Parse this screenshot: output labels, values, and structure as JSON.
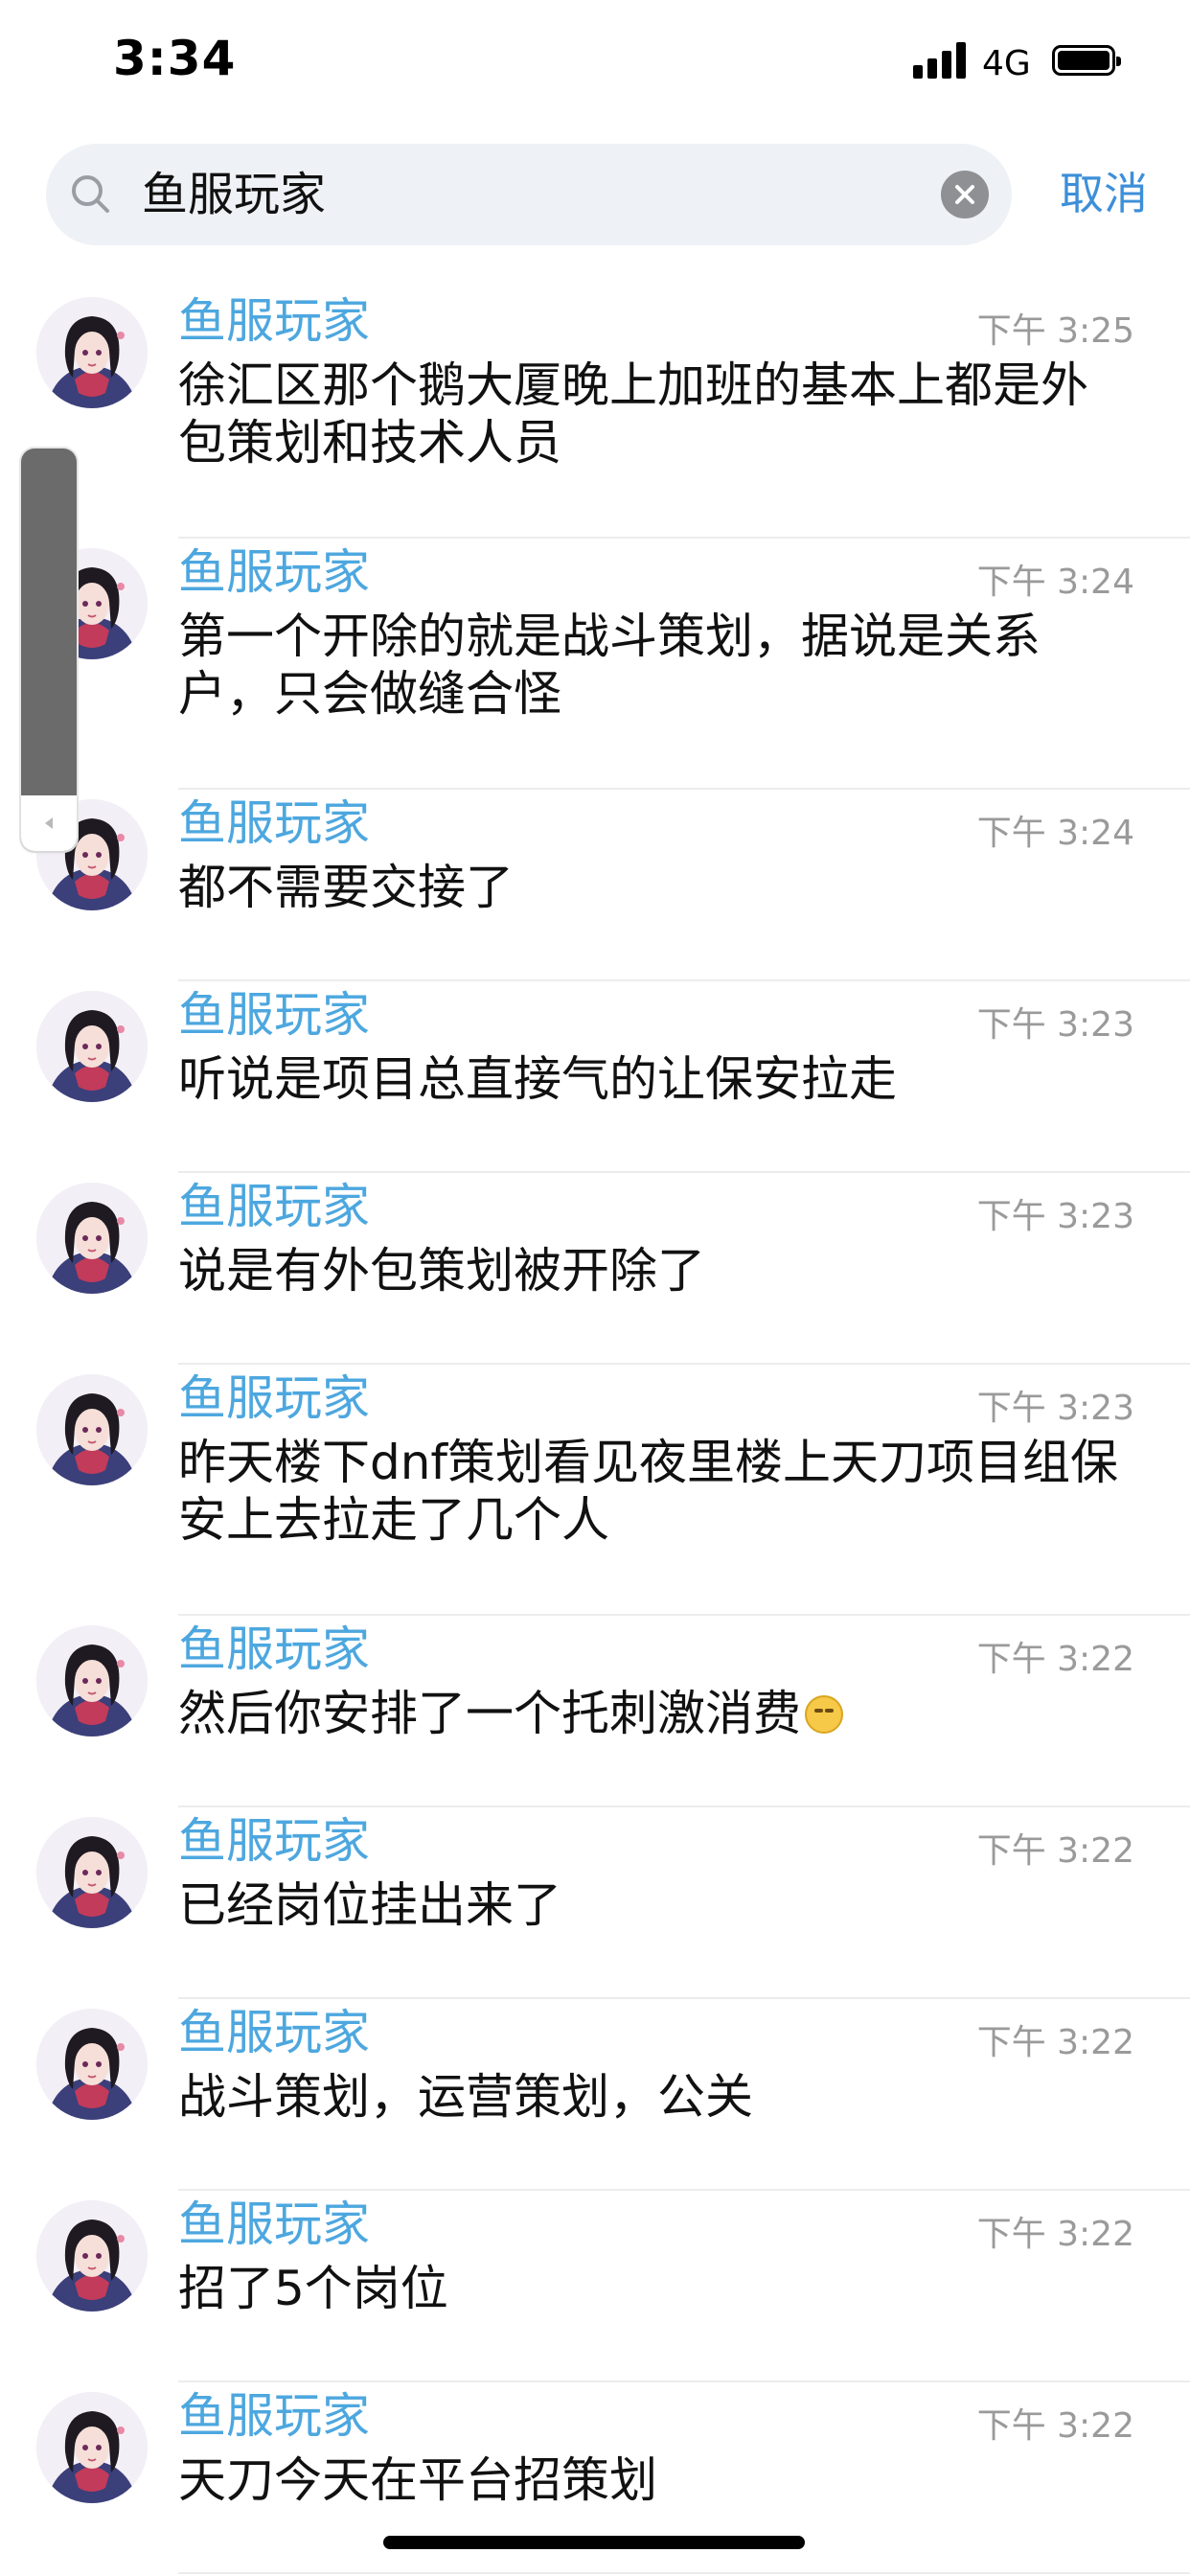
{
  "status_bar": {
    "time": "3:34",
    "network": "4G",
    "signal_icon": "signal-bars-icon",
    "battery_icon": "battery-full-icon"
  },
  "search": {
    "query": "鱼服玩家",
    "cancel_label": "取消",
    "icon": "search-icon",
    "clear_icon": "clear-icon"
  },
  "colors": {
    "accent": "#3d8fd8",
    "sender_name": "#4da7df",
    "timestamp": "#9a9a9a",
    "search_bg": "#eef1f5"
  },
  "results": [
    {
      "sender": "鱼服玩家",
      "time": "下午 3:25",
      "text": "徐汇区那个鹅大厦晚上加班的基本上都是外包策划和技术人员"
    },
    {
      "sender": "鱼服玩家",
      "time": "下午 3:24",
      "text": "第一个开除的就是战斗策划，据说是关系户，只会做缝合怪"
    },
    {
      "sender": "鱼服玩家",
      "time": "下午 3:24",
      "text": "都不需要交接了"
    },
    {
      "sender": "鱼服玩家",
      "time": "下午 3:23",
      "text": "听说是项目总直接气的让保安拉走"
    },
    {
      "sender": "鱼服玩家",
      "time": "下午 3:23",
      "text": "说是有外包策划被开除了"
    },
    {
      "sender": "鱼服玩家",
      "time": "下午 3:23",
      "text": "昨天楼下dnf策划看见夜里楼上天刀项目组保安上去拉走了几个人"
    },
    {
      "sender": "鱼服玩家",
      "time": "下午 3:22",
      "text": "然后你安排了一个托刺激消费",
      "emoji": "grimacing-emoji-icon"
    },
    {
      "sender": "鱼服玩家",
      "time": "下午 3:22",
      "text": "已经岗位挂出来了"
    },
    {
      "sender": "鱼服玩家",
      "time": "下午 3:22",
      "text": "战斗策划，运营策划，公关"
    },
    {
      "sender": "鱼服玩家",
      "time": "下午 3:22",
      "text": "招了5个岗位"
    },
    {
      "sender": "鱼服玩家",
      "time": "下午 3:22",
      "text": "天刀今天在平台招策划"
    }
  ]
}
